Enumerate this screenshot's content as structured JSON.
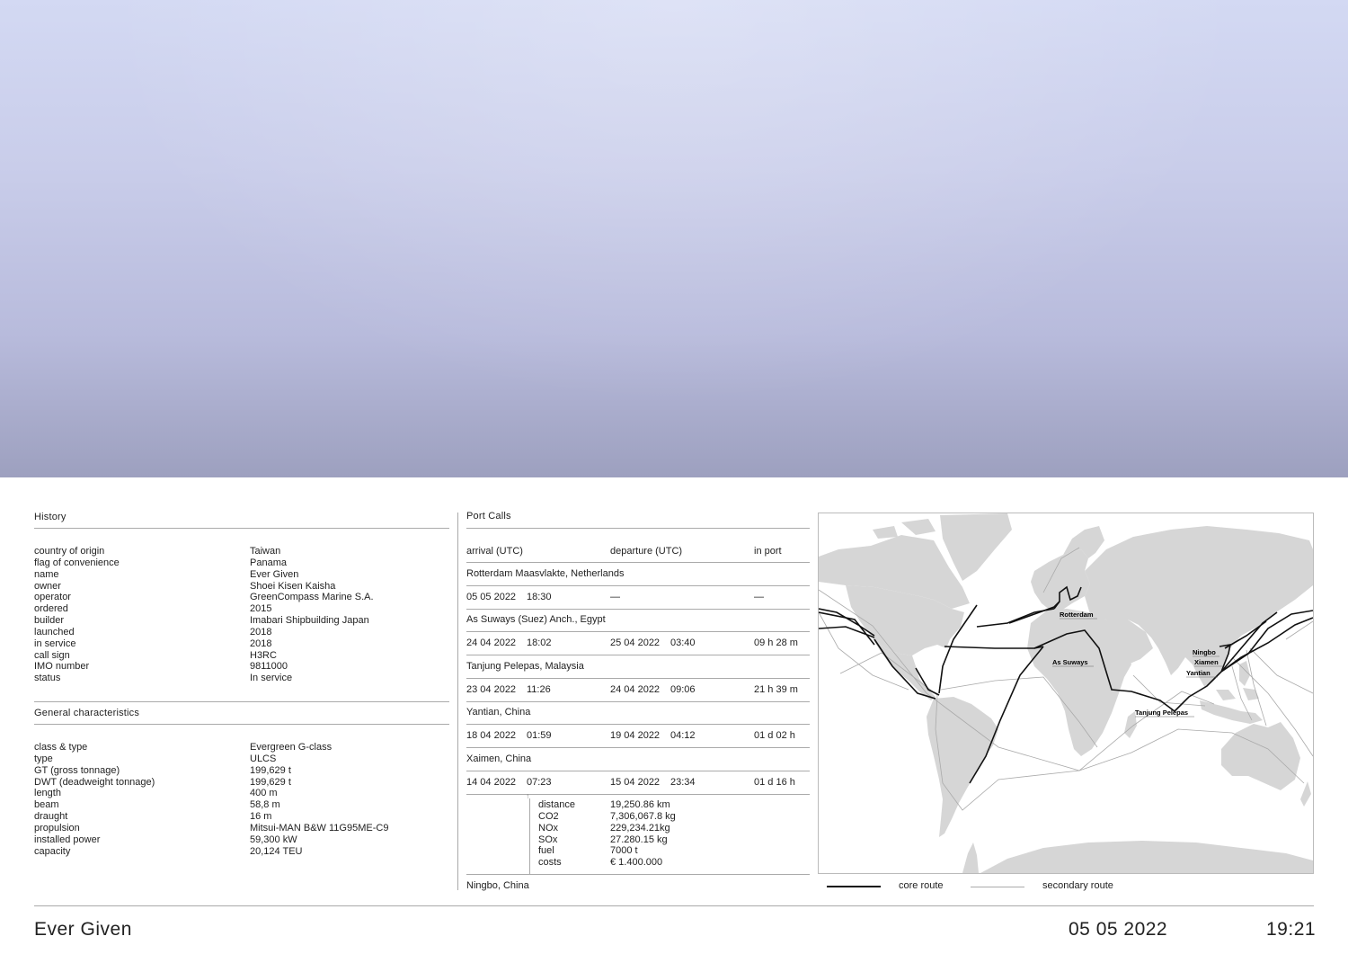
{
  "history": {
    "title": "History",
    "rows": [
      {
        "k": "country of origin",
        "v": "Taiwan"
      },
      {
        "k": "flag of convenience",
        "v": "Panama"
      },
      {
        "k": "name",
        "v": "Ever Given"
      },
      {
        "k": "owner",
        "v": "Shoei Kisen Kaisha"
      },
      {
        "k": "operator",
        "v": "GreenCompass Marine S.A."
      },
      {
        "k": "ordered",
        "v": "2015"
      },
      {
        "k": "builder",
        "v": "Imabari Shipbuilding Japan"
      },
      {
        "k": "launched",
        "v": "2018"
      },
      {
        "k": "in service",
        "v": "2018"
      },
      {
        "k": "call sign",
        "v": "H3RC"
      },
      {
        "k": "IMO number",
        "v": "9811000"
      },
      {
        "k": "status",
        "v": "In service"
      }
    ]
  },
  "general": {
    "title": "General characteristics",
    "rows": [
      {
        "k": "class & type",
        "v": "Evergreen G-class"
      },
      {
        "k": "type",
        "v": "ULCS"
      },
      {
        "k": "GT (gross tonnage)",
        "v": "199,629 t"
      },
      {
        "k": "DWT (deadweight tonnage)",
        "v": "199,629 t"
      },
      {
        "k": "length",
        "v": "400 m"
      },
      {
        "k": "beam",
        "v": "58,8 m"
      },
      {
        "k": "draught",
        "v": "16 m"
      },
      {
        "k": "propulsion",
        "v": "Mitsui-MAN B&W 11G95ME-C9"
      },
      {
        "k": "installed power",
        "v": "59,300 kW"
      },
      {
        "k": "capacity",
        "v": "20,124 TEU"
      }
    ]
  },
  "portcalls": {
    "title": "Port Calls",
    "headers": {
      "arrival": "arrival (UTC)",
      "departure": "departure (UTC)",
      "inport": "in port"
    },
    "ports": [
      {
        "name": "Rotterdam Maasvlakte, Netherlands",
        "arr_date": "05 05 2022",
        "arr_time": "18:30",
        "dep_date": "—",
        "dep_time": "",
        "inport": "—"
      },
      {
        "name": "As Suways (Suez) Anch., Egypt",
        "arr_date": "24 04 2022",
        "arr_time": "18:02",
        "dep_date": "25 04 2022",
        "dep_time": "03:40",
        "inport": "09 h  28 m"
      },
      {
        "name": "Tanjung Pelepas, Malaysia",
        "arr_date": "23 04 2022",
        "arr_time": "11:26",
        "dep_date": "24 04 2022",
        "dep_time": "09:06",
        "inport": "21 h  39 m"
      },
      {
        "name": "Yantian, China",
        "arr_date": "18 04 2022",
        "arr_time": "01:59",
        "dep_date": "19 04 2022",
        "dep_time": "04:12",
        "inport": "01 d  02 h"
      },
      {
        "name": "Xaimen, China",
        "arr_date": "14 04 2022",
        "arr_time": "07:23",
        "dep_date": "15 04 2022",
        "dep_time": "23:34",
        "inport": "01 d  16 h"
      }
    ],
    "stats": [
      {
        "k": "distance",
        "v": "19,250.86 km"
      },
      {
        "k": "CO2",
        "v": "7,306,067.8 kg"
      },
      {
        "k": "NOx",
        "v": "229,234.21kg"
      },
      {
        "k": "SOx",
        "v": "27.280.15 kg"
      },
      {
        "k": "fuel",
        "v": "7000 t"
      },
      {
        "k": "costs",
        "v": "€ 1.400.000"
      }
    ],
    "last_port": "Ningbo, China"
  },
  "map": {
    "labels": {
      "rotterdam": "Rotterdam",
      "suways": "As Suways",
      "ningbo": "Ningbo",
      "xiamen": "Xiamen",
      "yantian": "Yantian",
      "pelepas": "Tanjung Pelepas"
    },
    "legend": {
      "core": "core route",
      "secondary": "secondary route"
    },
    "colors": {
      "land": "#d6d6d6",
      "core": "#111111",
      "secondary": "#aaaaaa"
    }
  },
  "footer": {
    "ship": "Ever Given",
    "date": "05 05 2022",
    "time": "19:21"
  }
}
